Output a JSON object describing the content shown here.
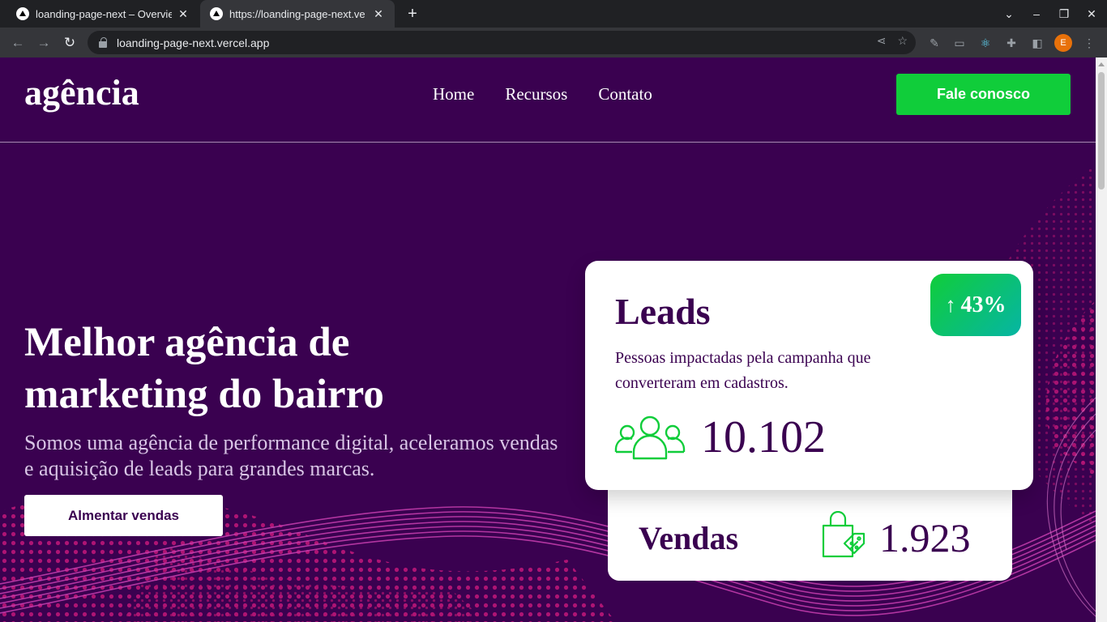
{
  "browser": {
    "tabs": [
      {
        "title": "loanding-page-next – Overvie",
        "close": "✕"
      },
      {
        "title": "https://loanding-page-next.ve",
        "close": "✕"
      }
    ],
    "new_tab": "+",
    "url": "loanding-page-next.vercel.app",
    "profile_initial": "E"
  },
  "header": {
    "logo": "agência",
    "nav": [
      "Home",
      "Recursos",
      "Contato"
    ],
    "cta": "Fale conosco"
  },
  "hero": {
    "title": "Melhor agência de marketing do bairro",
    "subtitle": "Somos uma agência de performance digital, aceleramos vendas e aquisição de leads para grandes marcas.",
    "button": "Almentar vendas"
  },
  "leads_card": {
    "title": "Leads",
    "badge": "43%",
    "description": "Pessoas impactadas pela campanha que converteram em cadastros.",
    "value": "10.102",
    "icon": "people-icon"
  },
  "sales_card": {
    "title": "Vendas",
    "value": "1.923",
    "icon": "shopping-bag-icon"
  },
  "colors": {
    "background": "#3a0150",
    "accent": "#10cd3a",
    "badge_end": "#06b5a4",
    "wave": "#c2177a"
  }
}
